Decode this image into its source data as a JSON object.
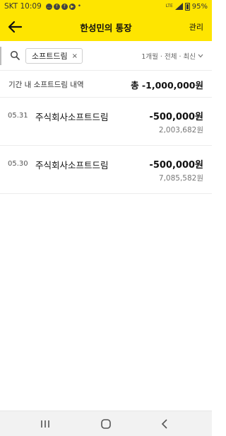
{
  "status_bar": {
    "carrier_time": "SKT 10:09",
    "network": "LTE",
    "battery_percent": "95%",
    "icons": [
      "message-icon",
      "facebook-icon",
      "facebook-icon",
      "youtube-icon",
      "more-dot"
    ]
  },
  "app_bar": {
    "back_icon": "arrow-left-icon",
    "title": "한성민의 통장",
    "manage_label": "관리",
    "background_color": "#fee500"
  },
  "filter": {
    "search_icon": "search-icon",
    "keyword_chip": "소프트드림",
    "chip_close": "×",
    "options_label": "1개월 · 전체 · 최신",
    "dropdown_icon": "chevron-down-icon"
  },
  "summary": {
    "label": "기간 내 소프트드림 내역",
    "total": "총 -1,000,000원"
  },
  "transactions": [
    {
      "date": "05.31",
      "name": "주식회사소프트드림",
      "amount": "-500,000원",
      "balance": "2,003,682원"
    },
    {
      "date": "05.30",
      "name": "주식회사소프트드림",
      "amount": "-500,000원",
      "balance": "7,085,582원"
    }
  ],
  "nav_bar": {
    "recents_icon": "recents-icon",
    "home_icon": "home-icon",
    "back_icon": "back-chevron-icon"
  }
}
